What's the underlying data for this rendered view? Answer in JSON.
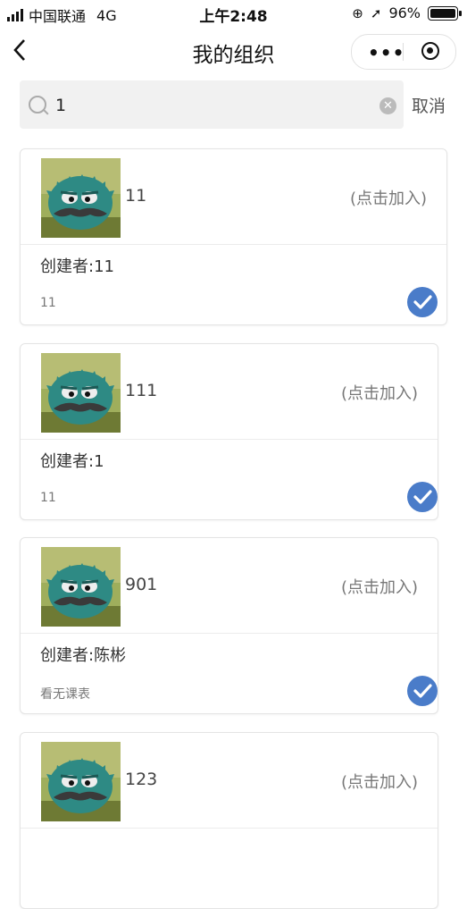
{
  "status_bar": {
    "carrier": "中国联通",
    "network": "4G",
    "time": "上午2:48",
    "battery": "96%"
  },
  "nav": {
    "title": "我的组织"
  },
  "search": {
    "value": "1",
    "cancel_label": "取消"
  },
  "orgs": [
    {
      "name": "11",
      "join_label": "(点击加入)",
      "creator": "创建者:11",
      "desc": "11"
    },
    {
      "name": "111",
      "join_label": "(点击加入)",
      "creator": "创建者:1",
      "desc": "11"
    },
    {
      "name": "901",
      "join_label": "(点击加入)",
      "creator": "创建者:陈彬",
      "desc": "看无课表"
    },
    {
      "name": "123",
      "join_label": "(点击加入)",
      "creator": "",
      "desc": ""
    }
  ],
  "colors": {
    "accent": "#4a7cc9"
  }
}
